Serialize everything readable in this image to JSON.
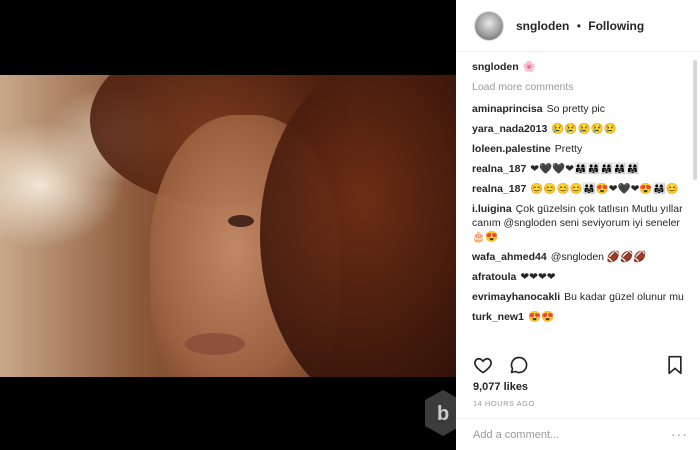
{
  "header": {
    "username": "sngloden",
    "separator": "•",
    "follow_status": "Following"
  },
  "caption": {
    "username": "sngloden",
    "text": "🌸"
  },
  "load_more": "Load more comments",
  "comments": [
    {
      "user": "aminaprincisa",
      "text": "So pretty pic"
    },
    {
      "user": "yara_nada2013",
      "text": "😢😢😢😢😢"
    },
    {
      "user": "loleen.palestine",
      "text": "Pretty"
    },
    {
      "user": "realna_187",
      "text": "❤🖤🖤❤👨‍👩‍👧👨‍👩‍👧👨‍👩‍👧👨‍👩‍👧👨‍👩‍👧"
    },
    {
      "user": "realna_187",
      "text": "😊😊😊😊👨‍👩‍👧😍❤🖤❤😍👨‍👩‍👧😊"
    },
    {
      "user": "i.luigina",
      "text": "Çok güzelsin çok tatlısın Mutlu yıllar canım @sngloden seni seviyorum iyi seneler 🎂😍"
    },
    {
      "user": "wafa_ahmed44",
      "text": "@sngloden 🏈🏈🏈"
    },
    {
      "user": "afratoula",
      "text": "❤❤❤❤"
    },
    {
      "user": "evrimayhanocakli",
      "text": "Bu kadar güzel olunur mu"
    },
    {
      "user": "turk_new1",
      "text": "😍😍"
    }
  ],
  "actions": {
    "like_icon": "heart-icon",
    "comment_icon": "comment-icon",
    "save_icon": "bookmark-icon"
  },
  "likes": "9,077 likes",
  "timestamp": "14 HOURS AGO",
  "add_comment": {
    "placeholder": "Add a comment..."
  },
  "more_icon": "···",
  "colors": {
    "text": "#262626",
    "muted": "#999999",
    "background": "#000000",
    "panel": "#ffffff"
  }
}
